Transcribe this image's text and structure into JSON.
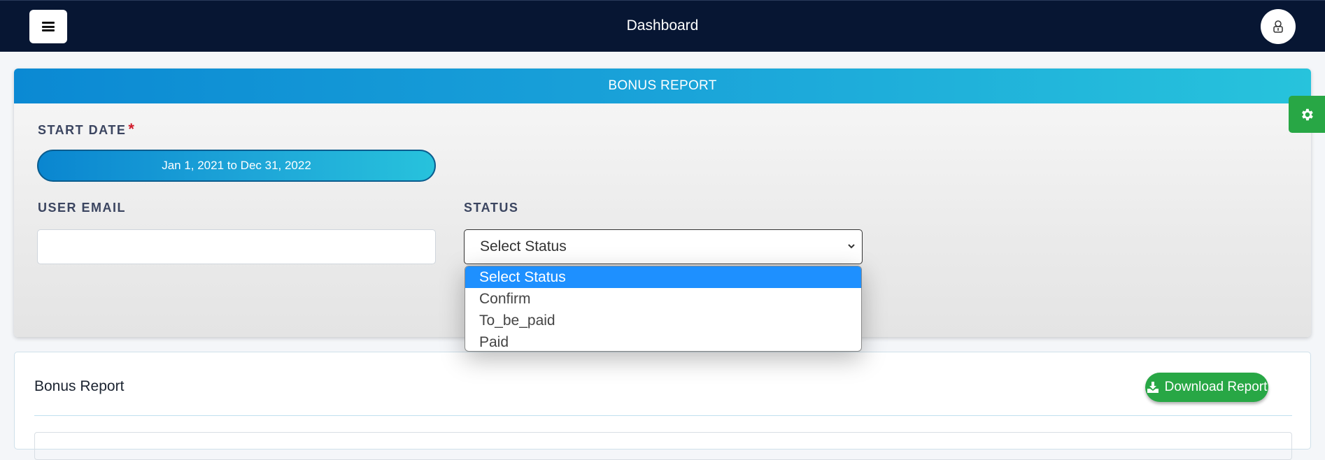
{
  "header": {
    "title": "Dashboard",
    "menu_icon": "hamburger-menu-icon",
    "profile_icon": "user-icon",
    "background": "#071633"
  },
  "filter": {
    "title": "BONUS REPORT",
    "start_date_label": "START DATE",
    "required_mark": "*",
    "date_range_value": "Jan 1, 2021 to Dec 31, 2022",
    "user_email_label": "USER EMAIL",
    "user_email_value": "",
    "status_label": "STATUS",
    "status_selected": "Select Status",
    "status_options": [
      "Select Status",
      "Confirm",
      "To_be_paid",
      "Paid"
    ],
    "status_dropdown_open": true,
    "accent": "#1aa3d9"
  },
  "settings": {
    "icon": "gear-icon",
    "color": "#28a745"
  },
  "report": {
    "title": "Bonus Report",
    "download_label": "Download Report",
    "download_icon": "download-icon",
    "button_color": "#28a745"
  }
}
